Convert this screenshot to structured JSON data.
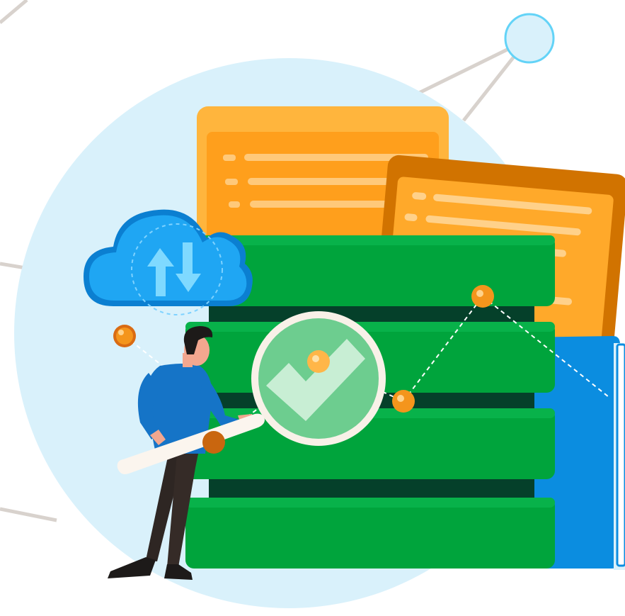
{
  "illustration": {
    "subject": "data-verification-illustration",
    "icons": [
      "cloud-sync-icon",
      "magnifier-icon",
      "checkmark-icon",
      "database-icon",
      "document-icon",
      "folder-icon",
      "person-icon",
      "network-node-icon"
    ]
  },
  "colors": {
    "background": "#ffffff",
    "circle": "#d9f1fb",
    "server_green": "#00a43c",
    "server_dark": "#05402a",
    "doc_orange": "#ffa92a",
    "doc_dark_orange": "#d17300",
    "folder_blue": "#0b8de0",
    "cloud_blue": "#1fa6f3",
    "node_orange": "#f4951c",
    "network_line": "#d8d2cd"
  }
}
